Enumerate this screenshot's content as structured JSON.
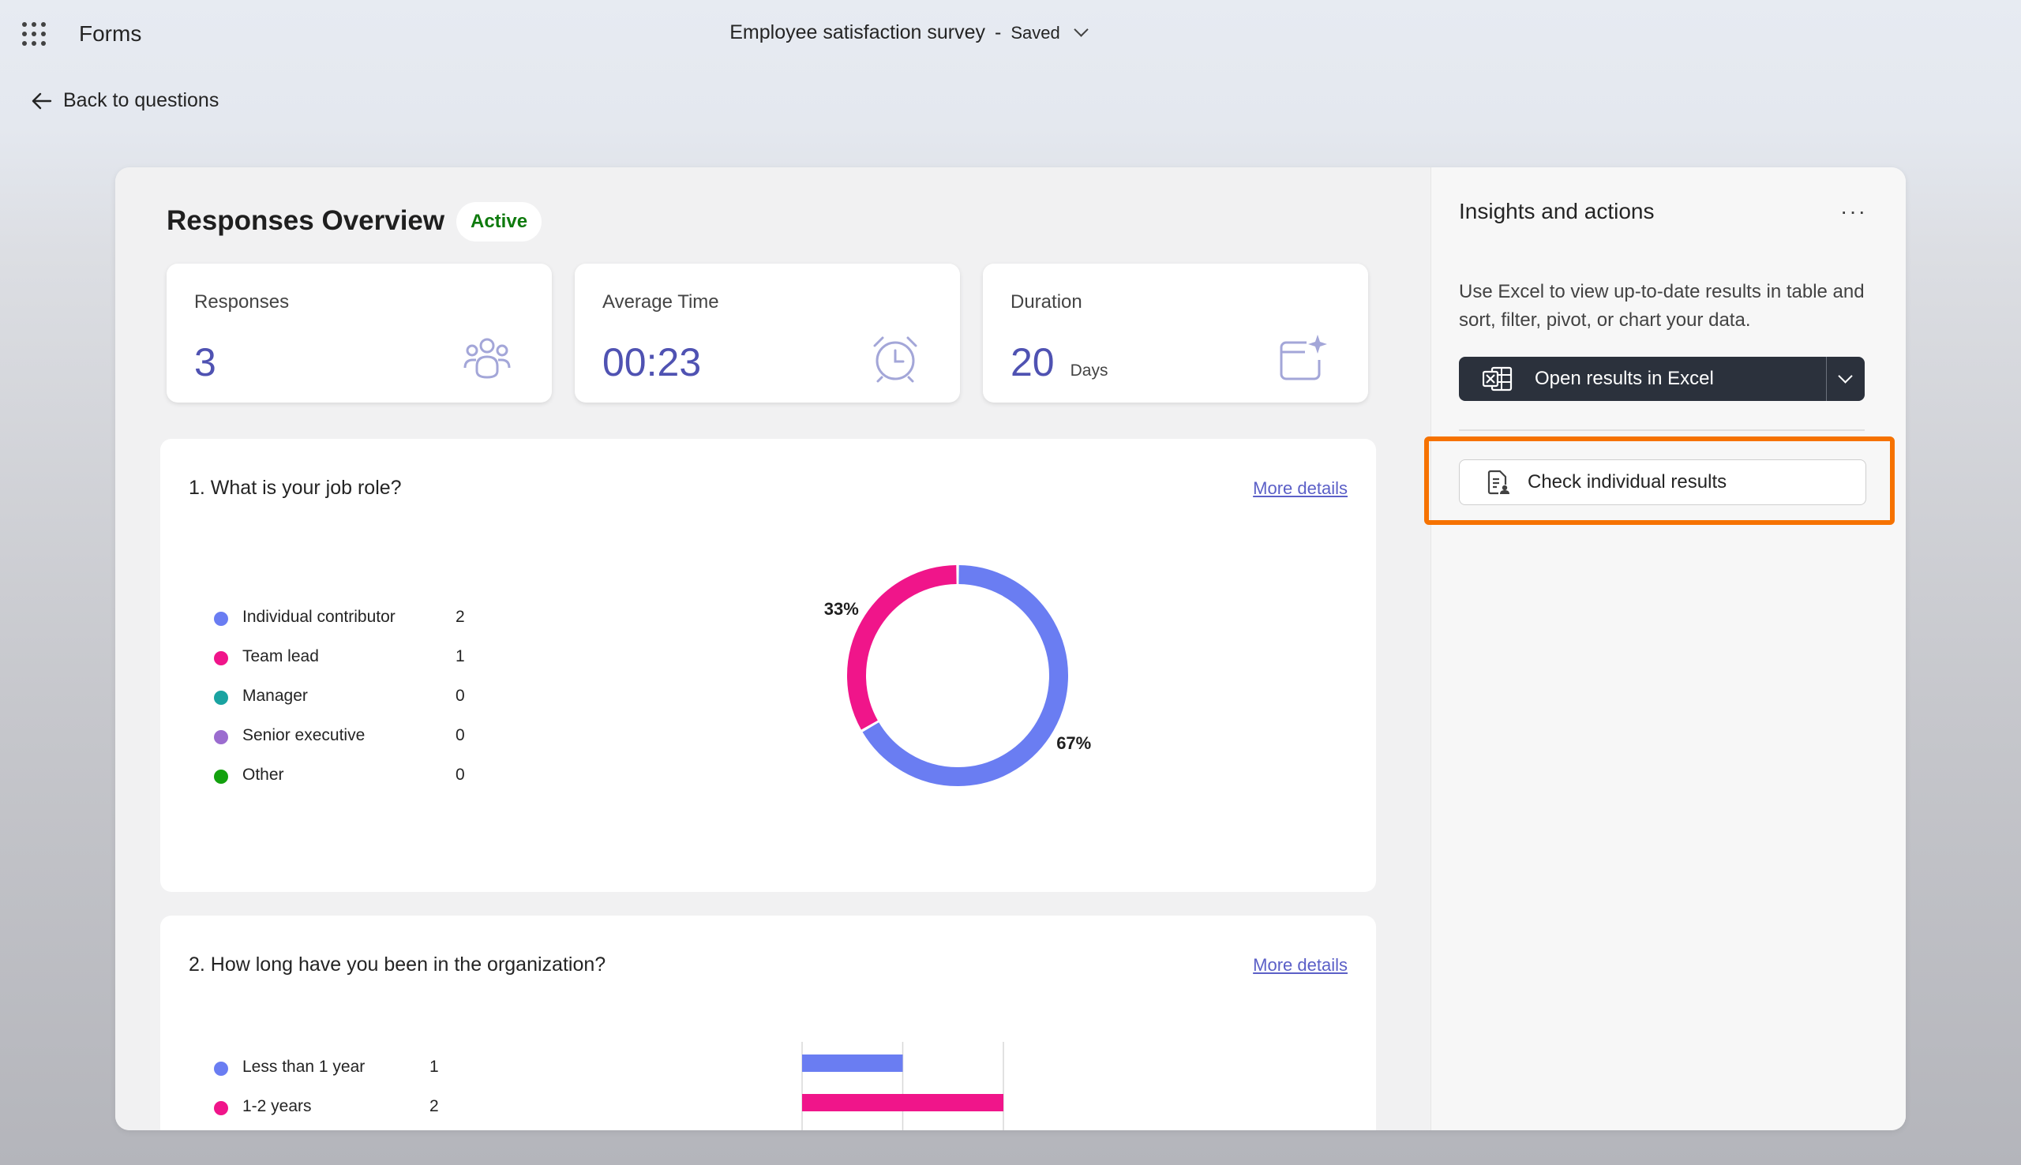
{
  "topbar": {
    "app_name": "Forms",
    "doc_title": "Employee satisfaction survey",
    "separator": "-",
    "save_status": "Saved",
    "waffle_icon": "app-launcher-icon"
  },
  "nav": {
    "back_label": "Back to questions"
  },
  "overview": {
    "title": "Responses Overview",
    "status": "Active",
    "stats": [
      {
        "label": "Responses",
        "value": "3",
        "unit": "",
        "icon": "people-icon"
      },
      {
        "label": "Average Time",
        "value": "00:23",
        "unit": "",
        "icon": "alarm-clock-icon"
      },
      {
        "label": "Duration",
        "value": "20",
        "unit": "Days",
        "icon": "calendar-sparkle-icon"
      }
    ]
  },
  "questions": [
    {
      "title": "1. What is your job role?",
      "more_label": "More details",
      "legend": [
        {
          "label": "Individual contributor",
          "count": "2",
          "color": "#6a7df2"
        },
        {
          "label": "Team lead",
          "count": "1",
          "color": "#f0158a"
        },
        {
          "label": "Manager",
          "count": "0",
          "color": "#1aa3a1"
        },
        {
          "label": "Senior executive",
          "count": "0",
          "color": "#9b6ccf"
        },
        {
          "label": "Other",
          "count": "0",
          "color": "#13a10e"
        }
      ]
    },
    {
      "title": "2. How long have you been in the organization?",
      "more_label": "More details",
      "legend": [
        {
          "label": "Less than 1 year",
          "count": "1",
          "color": "#6a7df2"
        },
        {
          "label": "1-2 years",
          "count": "2",
          "color": "#f0158a"
        }
      ]
    }
  ],
  "chart_data": [
    {
      "type": "pie",
      "categories": [
        "Individual contributor",
        "Team lead",
        "Manager",
        "Senior executive",
        "Other"
      ],
      "values": [
        2,
        1,
        0,
        0,
        0
      ],
      "labels": [
        "67%",
        "33%"
      ],
      "colors": [
        "#6a7df2",
        "#f0158a",
        "#1aa3a1",
        "#9b6ccf",
        "#13a10e"
      ]
    },
    {
      "type": "bar",
      "categories": [
        "Less than 1 year",
        "1-2 years"
      ],
      "values": [
        1,
        2
      ],
      "xlim": [
        0,
        2
      ],
      "grid": true,
      "colors": [
        "#6a7df2",
        "#f0158a"
      ]
    }
  ],
  "sidebar": {
    "title": "Insights and actions",
    "more_icon": "more-horizontal-icon",
    "description": "Use Excel to view up-to-date results in table and sort, filter, pivot, or chart your data.",
    "excel_button": "Open results in Excel",
    "check_button": "Check individual results",
    "highlight_color": "#f67200"
  }
}
